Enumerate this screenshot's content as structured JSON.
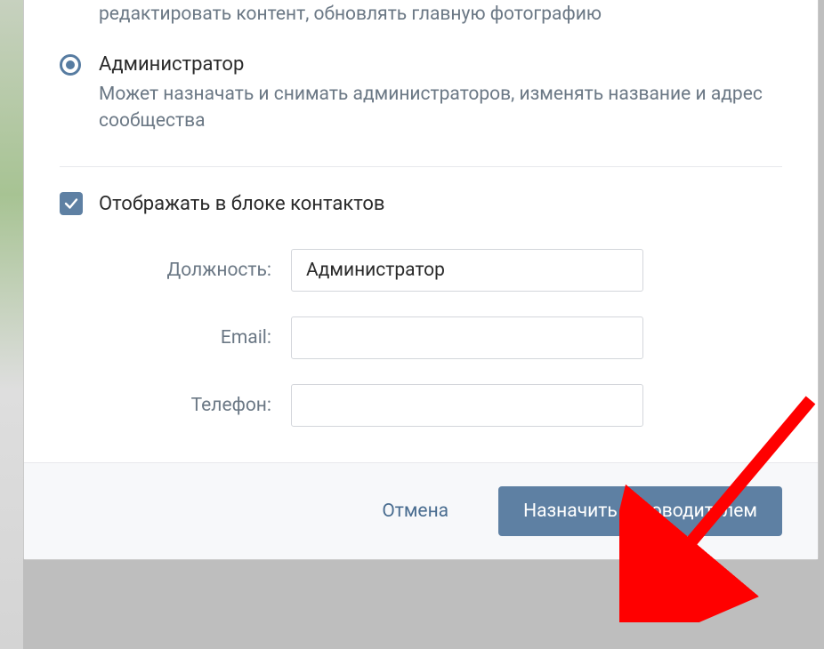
{
  "prev_role": {
    "description_truncated": "редактировать контент, обновлять главную фотографию"
  },
  "role_admin": {
    "label": "Администратор",
    "description": "Может назначать и снимать администраторов, изменять название и адрес сообщества",
    "selected": true
  },
  "contacts": {
    "checkbox_label": "Отображать в блоке контактов",
    "checked": true
  },
  "fields": {
    "position": {
      "label": "Должность:",
      "value": "Администратор"
    },
    "email": {
      "label": "Email:",
      "value": ""
    },
    "phone": {
      "label": "Телефон:",
      "value": ""
    }
  },
  "footer": {
    "cancel": "Отмена",
    "submit": "Назначить руководителем"
  }
}
